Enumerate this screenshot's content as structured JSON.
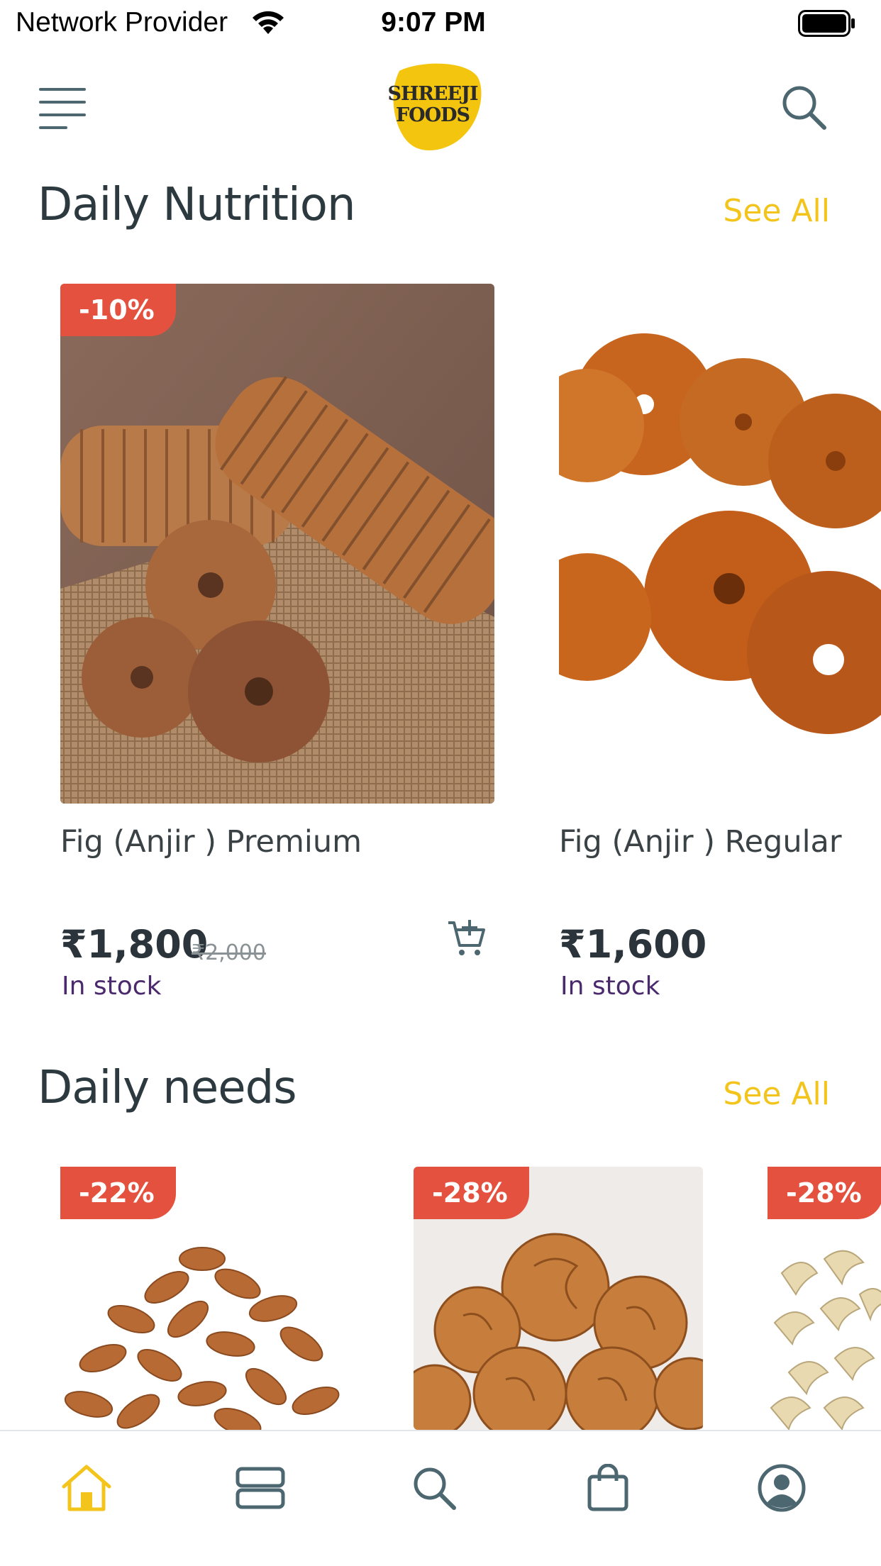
{
  "status_bar": {
    "carrier": "Network Provider",
    "time": "9:07 PM"
  },
  "header": {
    "logo_line1": "SHREEJI",
    "logo_line2": "FOODS",
    "icons": {
      "menu": "menu-icon",
      "search": "search-icon"
    }
  },
  "sections": [
    {
      "title": "Daily Nutrition",
      "see_all": "See All",
      "products": [
        {
          "name": "Fig (Anjir ) Premium",
          "price": "₹1,800",
          "old_price": "₹2,000",
          "stock": "In stock",
          "discount": "-10%"
        },
        {
          "name": "Fig (Anjir ) Regular",
          "price": "₹1,600",
          "old_price": "",
          "stock": "In stock",
          "discount": ""
        }
      ]
    },
    {
      "title": "Daily needs",
      "see_all": "See All",
      "products": [
        {
          "discount": "-22%"
        },
        {
          "discount": "-28%"
        },
        {
          "discount": "-28%"
        }
      ]
    }
  ],
  "tab_bar": {
    "tabs": [
      "home-icon",
      "categories-icon",
      "search-icon",
      "bag-icon",
      "profile-icon"
    ],
    "active": "home-icon"
  },
  "colors": {
    "accent": "#f3c51c",
    "badge": "#e4513f",
    "stock_text": "#4a2a6c",
    "icon": "#4d6771"
  }
}
